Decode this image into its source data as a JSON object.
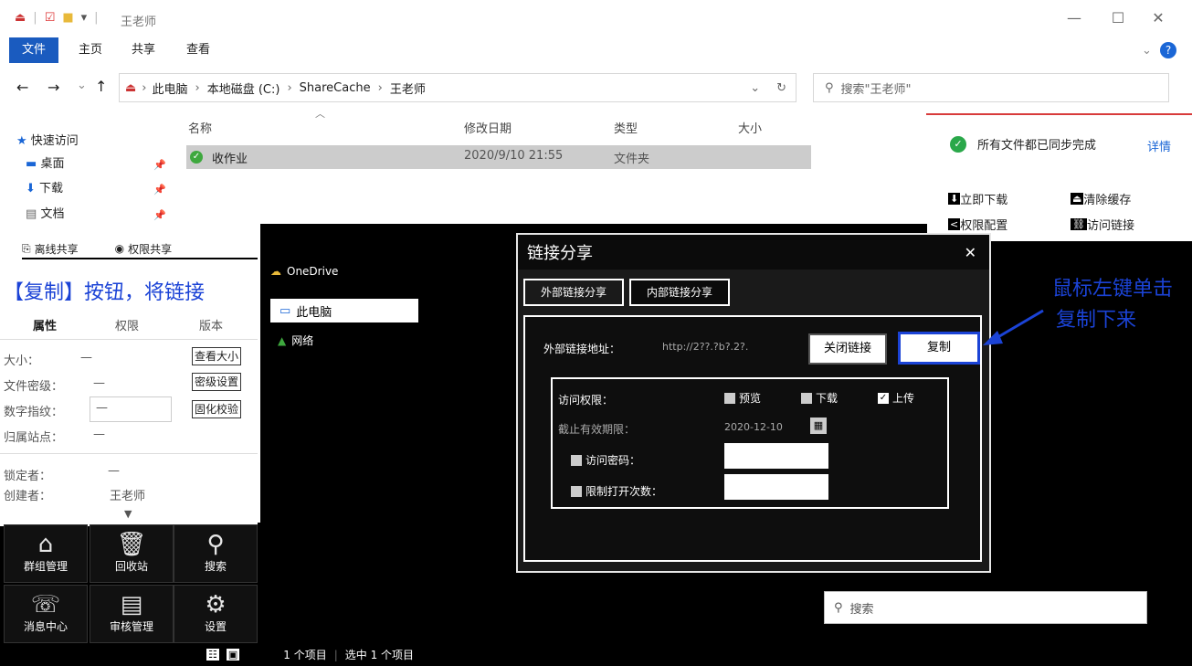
{
  "titlebar": {
    "title": "王老师",
    "minimize": "—",
    "maximize": "☐",
    "close": "✕"
  },
  "ribbon": {
    "tabs": [
      "文件",
      "主页",
      "共享",
      "查看"
    ]
  },
  "nav": {
    "back": "←",
    "forward": "→",
    "recent": "⌄",
    "up": "↑",
    "refresh": "↻",
    "dropdown": "⌄"
  },
  "address": {
    "parts": [
      "此电脑",
      "本地磁盘 (C:)",
      "ShareCache",
      "王老师"
    ],
    "sep": "›"
  },
  "search": {
    "placeholder": "搜索\"王老师\""
  },
  "sidebar": {
    "quick_access": "快速访问",
    "items": [
      {
        "label": "桌面",
        "icon": "desktop-icon"
      },
      {
        "label": "下载",
        "icon": "download-icon"
      },
      {
        "label": "文档",
        "icon": "document-icon"
      }
    ],
    "onedrive": "OneDrive",
    "this_pc": "此电脑",
    "network": "网络"
  },
  "columns": {
    "name": "名称",
    "date": "修改日期",
    "type": "类型",
    "size": "大小"
  },
  "files": [
    {
      "name": "收作业",
      "date": "2020/9/10 21:55",
      "type": "文件夹",
      "size": ""
    }
  ],
  "sync_panel": {
    "status": "所有文件都已同步完成",
    "details": "详情",
    "actions": [
      "立即下载",
      "清除缓存",
      "权限配置",
      "访问链接"
    ]
  },
  "share_row": {
    "left": "离线共享",
    "right": "权限共享"
  },
  "dialog": {
    "title": "链接分享",
    "tabs": [
      "外部链接分享",
      "内部链接分享"
    ],
    "link_label": "外部链接地址：",
    "link_value": "http://2??.?b?.2?.",
    "close_link": "关闭链接",
    "copy": "复制",
    "perm_label": "访问权限：",
    "perms": [
      {
        "label": "预览",
        "checked": false
      },
      {
        "label": "下载",
        "checked": false
      },
      {
        "label": "上传",
        "checked": true
      }
    ],
    "expire_label": "截止有效期限：",
    "expire_value": "2020-12-10",
    "password_label": "访问密码：",
    "limit_label": "限制打开次数："
  },
  "annotations": {
    "left": "【复制】按钮，将链接",
    "right_1": "鼠标左键单击",
    "right_2": "复制下来"
  },
  "props": {
    "tabs": [
      "属性",
      "权限",
      "版本"
    ],
    "rows": [
      {
        "label": "大小：",
        "value": "—",
        "button": "查看大小"
      },
      {
        "label": "文件密级：",
        "value": "—",
        "button": "密级设置"
      },
      {
        "label": "数字指纹：",
        "value": "—",
        "button": "固化校验"
      },
      {
        "label": "归属站点：",
        "value": "—",
        "button": ""
      }
    ],
    "lock_label": "锁定者：",
    "lock_value": "—",
    "creator_label": "创建者：",
    "creator_value": "王老师"
  },
  "tools": [
    {
      "label": "群组管理",
      "icon": "group-icon"
    },
    {
      "label": "回收站",
      "icon": "recycle-icon"
    },
    {
      "label": "搜索",
      "icon": "search-icon"
    },
    {
      "label": "消息中心",
      "icon": "message-icon"
    },
    {
      "label": "审核管理",
      "icon": "audit-icon"
    },
    {
      "label": "设置",
      "icon": "settings-icon"
    }
  ],
  "status": {
    "count": "1 个项目",
    "selected": "选中 1 个项目"
  },
  "bottom_search": "搜索"
}
